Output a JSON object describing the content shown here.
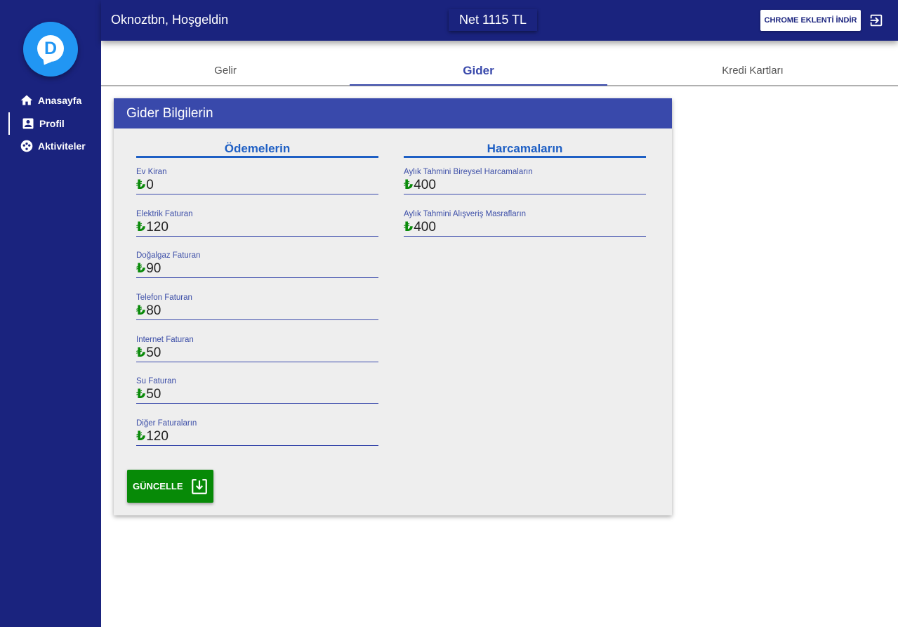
{
  "sidebar": {
    "logo_letter": "D",
    "items": [
      {
        "label": "Anasayfa",
        "icon": "home-icon"
      },
      {
        "label": "Profil",
        "icon": "profile-icon"
      },
      {
        "label": "Aktiviteler",
        "icon": "activity-icon"
      }
    ]
  },
  "header": {
    "greeting": "Oknoztbn, Hoşgeldin",
    "net": "Net 1115 TL",
    "chrome_button": "CHROME EKLENTİ İNDİR",
    "logout_icon": "logout-icon"
  },
  "tabs": [
    {
      "label": "Gelir",
      "active": false
    },
    {
      "label": "Gider",
      "active": true
    },
    {
      "label": "Kredi Kartları",
      "active": false
    }
  ],
  "card": {
    "title": "Gider Bilgilerin",
    "currency_symbol": "₺",
    "payments": {
      "title": "Ödemelerin",
      "fields": [
        {
          "label": "Ev Kiran",
          "value": "0"
        },
        {
          "label": "Elektrik Faturan",
          "value": "120"
        },
        {
          "label": "Doğalgaz Faturan",
          "value": "90"
        },
        {
          "label": "Telefon Faturan",
          "value": "80"
        },
        {
          "label": "Internet Faturan",
          "value": "50"
        },
        {
          "label": "Su Faturan",
          "value": "50"
        },
        {
          "label": "Diğer Faturaların",
          "value": "120"
        }
      ]
    },
    "spending": {
      "title": "Harcamaların",
      "fields": [
        {
          "label": "Aylık Tahmini Bireysel Harcamaların",
          "value": "400"
        },
        {
          "label": "Aylık Tahmini Alışveriş Masrafların",
          "value": "400"
        }
      ]
    },
    "update_button": "GÜNCELLE"
  },
  "colors": {
    "primary": "#1a237e",
    "accent": "#3949ab",
    "column_title": "#1e5fc4",
    "update_button": "#078a07",
    "currency": "#0a8a0a"
  }
}
